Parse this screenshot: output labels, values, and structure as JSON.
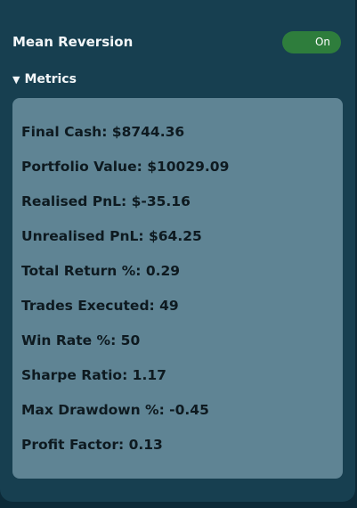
{
  "strategy": {
    "title": "Mean Reversion",
    "toggle_label": "On",
    "toggle_color": "#2e7d3c"
  },
  "metrics": {
    "header": "Metrics",
    "caret": "▼",
    "items": [
      "Final Cash: $8744.36",
      "Portfolio Value: $10029.09",
      "Realised PnL: $-35.16",
      "Unrealised PnL: $64.25",
      "Total Return %: 0.29",
      "Trades Executed: 49",
      "Win Rate %: 50",
      "Sharpe Ratio: 1.17",
      "Max Drawdown %: -0.45",
      "Profit Factor: 0.13"
    ]
  }
}
